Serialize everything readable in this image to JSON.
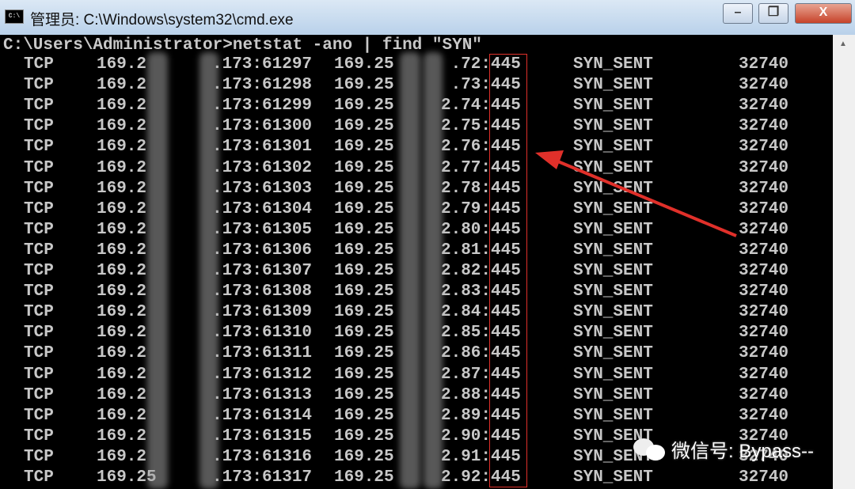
{
  "window": {
    "title": "管理员: C:\\Windows\\system32\\cmd.exe",
    "app_icon": "cmd-icon",
    "buttons": {
      "minimize": "–",
      "maximize": "❐",
      "close": "X"
    }
  },
  "console": {
    "command_line": "C:\\Users\\Administrator>netstat -ano | find \"SYN\"",
    "rows": [
      {
        "proto": "TCP",
        "local_prefix": "169.2",
        "local_suffix": ".173:61297",
        "remote_prefix": "169.25",
        "remote_suffix": ".72:",
        "port": "445",
        "state": "SYN_SENT",
        "pid": "32740"
      },
      {
        "proto": "TCP",
        "local_prefix": "169.2",
        "local_suffix": ".173:61298",
        "remote_prefix": "169.25",
        "remote_suffix": ".73:",
        "port": "445",
        "state": "SYN_SENT",
        "pid": "32740"
      },
      {
        "proto": "TCP",
        "local_prefix": "169.2",
        "local_suffix": ".173:61299",
        "remote_prefix": "169.25",
        "remote_suffix": "2.74:",
        "port": "445",
        "state": "SYN_SENT",
        "pid": "32740"
      },
      {
        "proto": "TCP",
        "local_prefix": "169.2",
        "local_suffix": ".173:61300",
        "remote_prefix": "169.25",
        "remote_suffix": "2.75:",
        "port": "445",
        "state": "SYN_SENT",
        "pid": "32740"
      },
      {
        "proto": "TCP",
        "local_prefix": "169.2",
        "local_suffix": ".173:61301",
        "remote_prefix": "169.25",
        "remote_suffix": "2.76:",
        "port": "445",
        "state": "SYN_SENT",
        "pid": "32740"
      },
      {
        "proto": "TCP",
        "local_prefix": "169.2",
        "local_suffix": ".173:61302",
        "remote_prefix": "169.25",
        "remote_suffix": "2.77:",
        "port": "445",
        "state": "SYN_SENT",
        "pid": "32740"
      },
      {
        "proto": "TCP",
        "local_prefix": "169.2",
        "local_suffix": ".173:61303",
        "remote_prefix": "169.25",
        "remote_suffix": "2.78:",
        "port": "445",
        "state": "SYN_SENT",
        "pid": "32740"
      },
      {
        "proto": "TCP",
        "local_prefix": "169.2",
        "local_suffix": ".173:61304",
        "remote_prefix": "169.25",
        "remote_suffix": "2.79:",
        "port": "445",
        "state": "SYN_SENT",
        "pid": "32740"
      },
      {
        "proto": "TCP",
        "local_prefix": "169.2",
        "local_suffix": ".173:61305",
        "remote_prefix": "169.25",
        "remote_suffix": "2.80:",
        "port": "445",
        "state": "SYN_SENT",
        "pid": "32740"
      },
      {
        "proto": "TCP",
        "local_prefix": "169.2",
        "local_suffix": ".173:61306",
        "remote_prefix": "169.25",
        "remote_suffix": "2.81:",
        "port": "445",
        "state": "SYN_SENT",
        "pid": "32740"
      },
      {
        "proto": "TCP",
        "local_prefix": "169.2",
        "local_suffix": ".173:61307",
        "remote_prefix": "169.25",
        "remote_suffix": "2.82:",
        "port": "445",
        "state": "SYN_SENT",
        "pid": "32740"
      },
      {
        "proto": "TCP",
        "local_prefix": "169.2",
        "local_suffix": ".173:61308",
        "remote_prefix": "169.25",
        "remote_suffix": "2.83:",
        "port": "445",
        "state": "SYN_SENT",
        "pid": "32740"
      },
      {
        "proto": "TCP",
        "local_prefix": "169.2",
        "local_suffix": ".173:61309",
        "remote_prefix": "169.25",
        "remote_suffix": "2.84:",
        "port": "445",
        "state": "SYN_SENT",
        "pid": "32740"
      },
      {
        "proto": "TCP",
        "local_prefix": "169.2",
        "local_suffix": ".173:61310",
        "remote_prefix": "169.25",
        "remote_suffix": "2.85:",
        "port": "445",
        "state": "SYN_SENT",
        "pid": "32740"
      },
      {
        "proto": "TCP",
        "local_prefix": "169.2",
        "local_suffix": ".173:61311",
        "remote_prefix": "169.25",
        "remote_suffix": "2.86:",
        "port": "445",
        "state": "SYN_SENT",
        "pid": "32740"
      },
      {
        "proto": "TCP",
        "local_prefix": "169.2",
        "local_suffix": ".173:61312",
        "remote_prefix": "169.25",
        "remote_suffix": "2.87:",
        "port": "445",
        "state": "SYN_SENT",
        "pid": "32740"
      },
      {
        "proto": "TCP",
        "local_prefix": "169.2",
        "local_suffix": ".173:61313",
        "remote_prefix": "169.25",
        "remote_suffix": "2.88:",
        "port": "445",
        "state": "SYN_SENT",
        "pid": "32740"
      },
      {
        "proto": "TCP",
        "local_prefix": "169.2",
        "local_suffix": ".173:61314",
        "remote_prefix": "169.25",
        "remote_suffix": "2.89:",
        "port": "445",
        "state": "SYN_SENT",
        "pid": "32740"
      },
      {
        "proto": "TCP",
        "local_prefix": "169.2",
        "local_suffix": ".173:61315",
        "remote_prefix": "169.25",
        "remote_suffix": "2.90:",
        "port": "445",
        "state": "SYN_SENT",
        "pid": "32740"
      },
      {
        "proto": "TCP",
        "local_prefix": "169.2",
        "local_suffix": ".173:61316",
        "remote_prefix": "169.25",
        "remote_suffix": "2.91:",
        "port": "445",
        "state": "SYN_SENT",
        "pid": "32740"
      },
      {
        "proto": "TCP",
        "local_prefix": "169.25",
        "local_suffix": ".173:61317",
        "remote_prefix": "169.25",
        "remote_suffix": "2.92:",
        "port": "445",
        "state": "SYN_SENT",
        "pid": "32740"
      }
    ]
  },
  "annotation": {
    "highlight_color": "#e0302a"
  },
  "watermark": {
    "text": "微信号: Bypass--",
    "icon": "wechat-icon"
  }
}
